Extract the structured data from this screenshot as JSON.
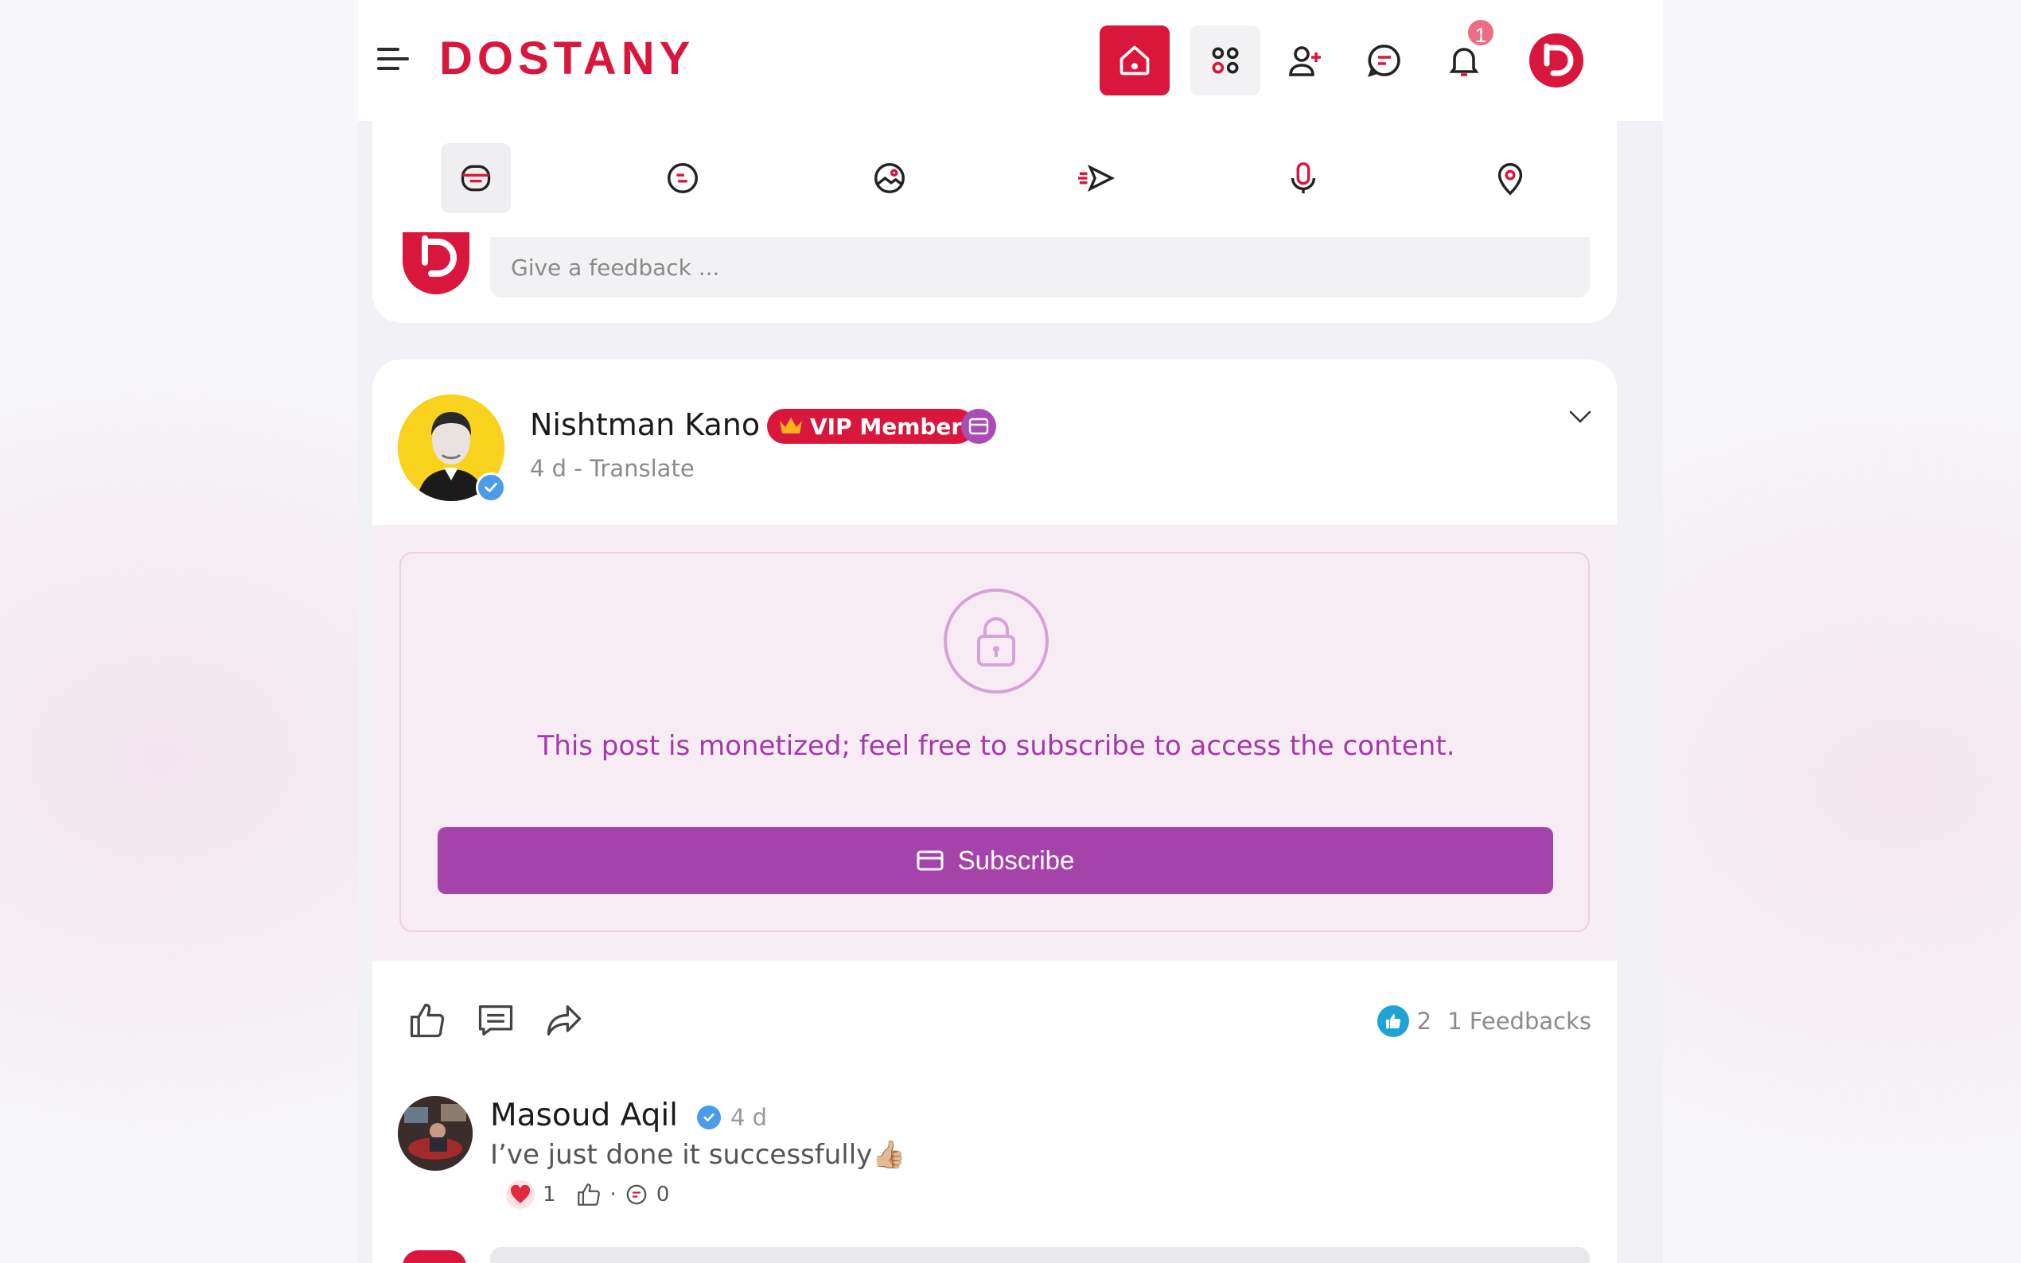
{
  "app": {
    "logo_text": "DOSTANY",
    "brand_color": "#d9173c",
    "accent_color": "#a643ab"
  },
  "topbar": {
    "menu_icon": "hamburger-icon",
    "nav": [
      {
        "icon": "home-icon",
        "active": true
      },
      {
        "icon": "apps-grid-icon"
      },
      {
        "icon": "add-user-icon"
      },
      {
        "icon": "messages-icon"
      },
      {
        "icon": "bell-icon",
        "badge": "1"
      },
      {
        "icon": "profile-logo-icon"
      }
    ]
  },
  "composer": {
    "tabs": [
      "text-post-icon",
      "feeling-icon",
      "photo-icon",
      "boost-icon",
      "microphone-icon",
      "location-icon"
    ],
    "placeholder": "Give a feedback ..."
  },
  "post": {
    "author_name": "Nishtman Kano",
    "vip_label": "VIP Member",
    "time": "4 d",
    "separator": "-",
    "translate_label": "Translate",
    "locked_message": "This post is monetized; feel free to subscribe to access the content.",
    "subscribe_label": "Subscribe",
    "reaction_count": "2",
    "feedbacks_label": "1 Feedbacks"
  },
  "comment": {
    "author_name": "Masoud Aqil",
    "time": "4 d",
    "text": "I’ve just done it successfully👍🏼",
    "heart_count": "1",
    "dot": "·",
    "reply_count": "0"
  }
}
